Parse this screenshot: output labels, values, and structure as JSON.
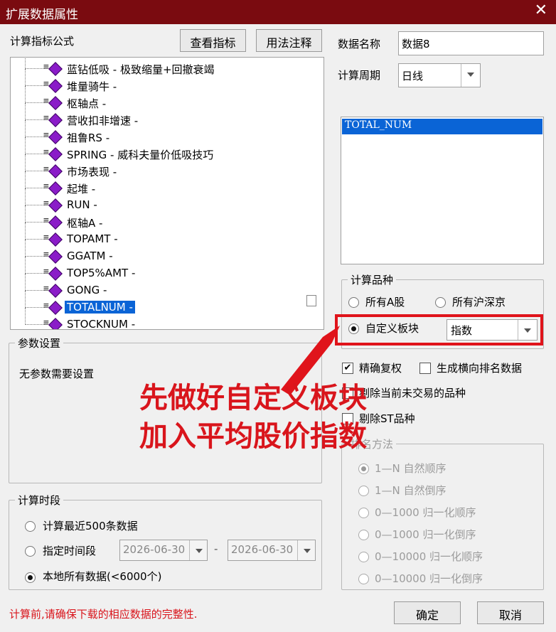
{
  "window": {
    "title": "扩展数据属性",
    "close": "✕"
  },
  "formula": {
    "label": "计算指标公式",
    "view_button": "查看指标",
    "usage_button": "用法注释",
    "items": [
      {
        "label": "蓝钻低吸 - 极致缩量+回撤衰竭"
      },
      {
        "label": "堆量骑牛 -"
      },
      {
        "label": "枢轴点 -"
      },
      {
        "label": "营收扣非增速 -"
      },
      {
        "label": "祖鲁RS -"
      },
      {
        "label": "SPRING - 威科夫量价低吸技巧"
      },
      {
        "label": "市场表现 -"
      },
      {
        "label": "起堆 -"
      },
      {
        "label": "RUN -"
      },
      {
        "label": "枢轴A -"
      },
      {
        "label": "TOPAMT -"
      },
      {
        "label": "GGATM -"
      },
      {
        "label": "TOP5%AMT -"
      },
      {
        "label": "GONG -"
      },
      {
        "label": "TOTALNUM -"
      },
      {
        "label": "STOCKNUM -"
      }
    ],
    "selected_index": 14
  },
  "data_name": {
    "label": "数据名称",
    "value": "数据8"
  },
  "period": {
    "label": "计算周期",
    "value": "日线"
  },
  "output_list": {
    "items": [
      "TOTAL_NUM"
    ]
  },
  "params": {
    "label": "参数设置",
    "text": "无参数需要设置"
  },
  "variety": {
    "label": "计算品种",
    "all_a": "所有A股",
    "all_hs": "所有沪深京",
    "custom": "自定义板块",
    "custom_value": "指数"
  },
  "options": {
    "precise": "精确复权",
    "ranking": "生成横向排名数据",
    "exclude_notrade": "剔除当前未交易的品种",
    "exclude_st": "剔除ST品种"
  },
  "rank_method": {
    "label": "排名方法",
    "items": [
      "1—N 自然顺序",
      "1—N 自然倒序",
      "0—1000 归一化顺序",
      "0—1000 归一化倒序",
      "0—10000 归一化顺序",
      "0—10000 归一化倒序"
    ]
  },
  "period_range": {
    "label": "计算时段",
    "recent": "计算最近500条数据",
    "specify": "指定时间段",
    "start": "2026-06-30",
    "dash": "-",
    "end": "2026-06-30",
    "local": "本地所有数据(<6000个)"
  },
  "footer": {
    "warning": "计算前,请确保下载的相应数据的完整性.",
    "ok": "确定",
    "cancel": "取消"
  },
  "annotation": {
    "line1": "先做好自定义板块",
    "line2": "加入平均股价指数"
  },
  "colors": {
    "title_bar": "#7a0b10",
    "selection": "#0a64d6",
    "annotation": "#d9151c"
  }
}
